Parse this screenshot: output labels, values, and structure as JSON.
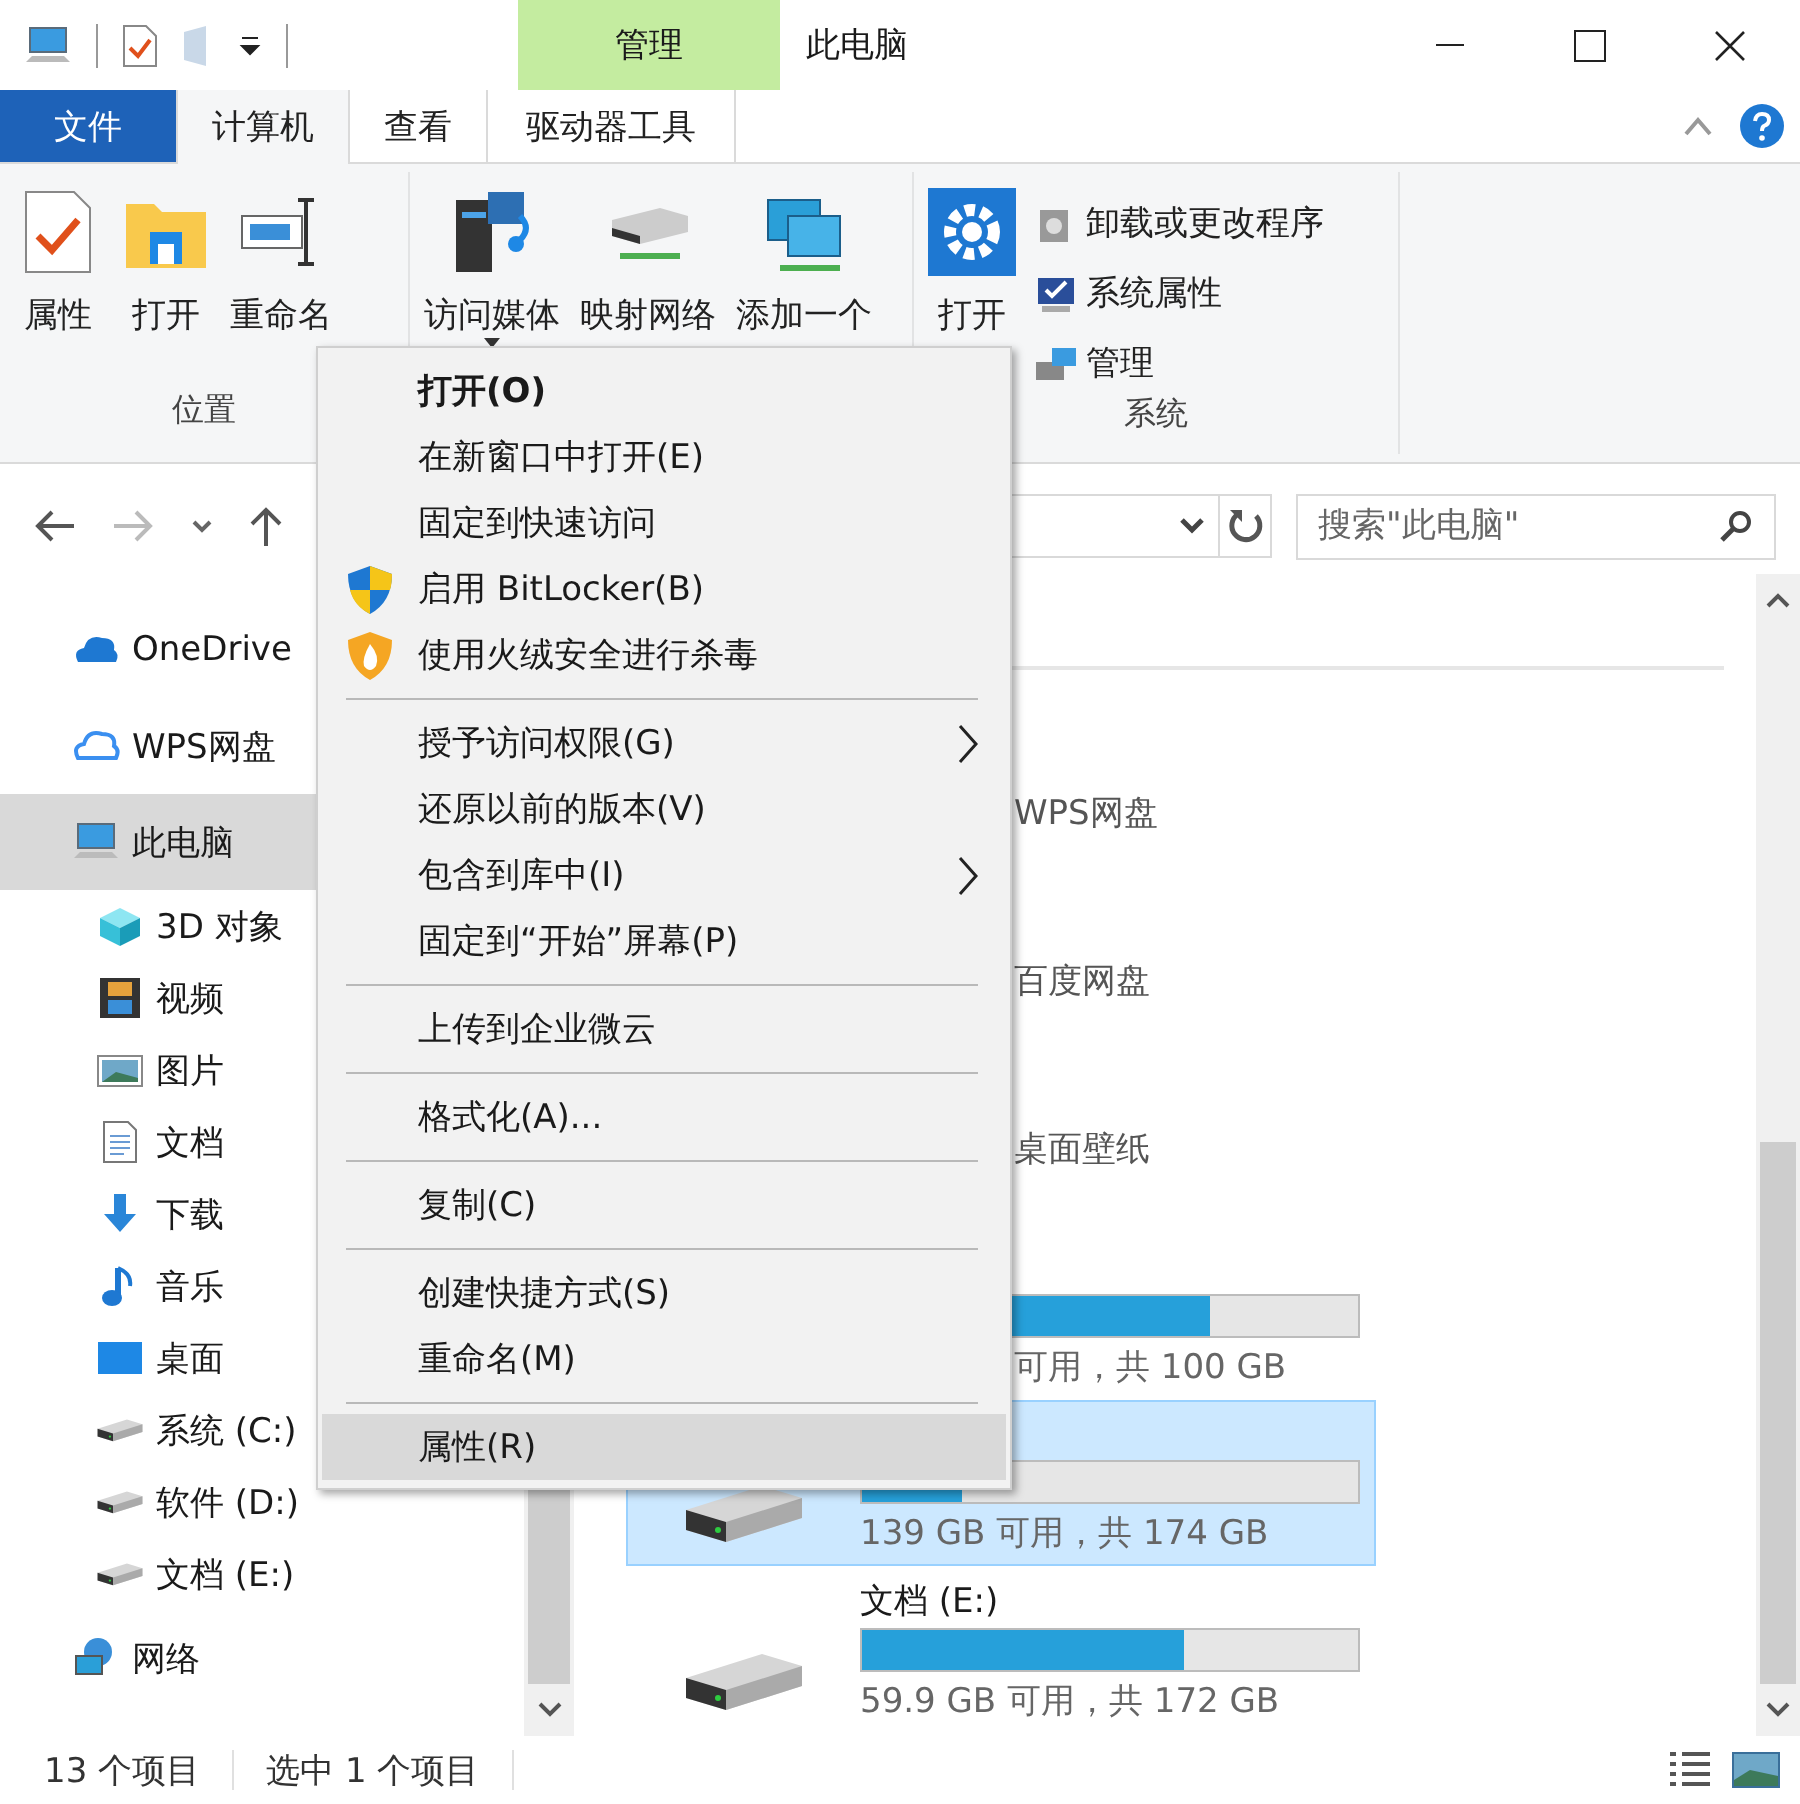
{
  "title_bar": {
    "contextual_tab": "管理",
    "title": "此电脑"
  },
  "ribbon_tabs": [
    {
      "label": "文件",
      "kind": "file",
      "selected": false
    },
    {
      "label": "计算机",
      "kind": "tab",
      "selected": true
    },
    {
      "label": "查看",
      "kind": "tab",
      "selected": false
    },
    {
      "label": "驱动器工具",
      "kind": "contextual",
      "selected": false
    }
  ],
  "ribbon_groups": [
    {
      "label": "位置",
      "buttons": [
        {
          "label": "属性",
          "dropdown": false
        },
        {
          "label": "打开",
          "dropdown": false
        },
        {
          "label": "重命名",
          "dropdown": false
        }
      ]
    },
    {
      "buttons": [
        {
          "label": "访问媒体",
          "dropdown": true
        },
        {
          "label": "映射网络",
          "dropdown": false
        },
        {
          "label": "添加一个",
          "dropdown": false
        }
      ]
    },
    {
      "label": "系统",
      "buttons": [
        {
          "label": "打开",
          "dropdown": false
        }
      ],
      "small_buttons": [
        "卸载或更改程序",
        "系统属性",
        "管理"
      ]
    }
  ],
  "search": {
    "placeholder": "搜索\"此电脑\""
  },
  "sidebar": [
    {
      "label": "OneDrive",
      "selected": false
    },
    {
      "label": "WPS网盘",
      "selected": false
    },
    {
      "label": "此电脑",
      "selected": true,
      "children": [
        {
          "label": "3D 对象",
          "selected": false
        },
        {
          "label": "视频",
          "selected": false
        },
        {
          "label": "图片",
          "selected": false
        },
        {
          "label": "文档",
          "selected": false
        },
        {
          "label": "下载",
          "selected": false
        },
        {
          "label": "音乐",
          "selected": false
        },
        {
          "label": "桌面",
          "selected": false
        },
        {
          "label": "系统 (C:)",
          "selected": false
        },
        {
          "label": "软件 (D:)",
          "selected": false
        },
        {
          "label": "文档 (E:)",
          "selected": false
        }
      ]
    },
    {
      "label": "网络",
      "selected": false
    }
  ],
  "content": {
    "folders": [
      "WPS网盘",
      "百度网盘",
      "桌面壁纸"
    ],
    "drives": [
      {
        "selected": false,
        "level": 0.7,
        "info": "可用，共 100 GB"
      },
      {
        "selected": true,
        "level": 0.2,
        "info": "139 GB 可用，共 174 GB"
      },
      {
        "name": "文档 (E:)",
        "selected": false,
        "level": 0.65,
        "info": "59.9 GB 可用，共 172 GB"
      }
    ]
  },
  "context_menu": {
    "sections": [
      [
        {
          "label": "打开(O)",
          "bold": true,
          "submenu": false,
          "selected": false
        },
        {
          "label": "在新窗口中打开(E)",
          "bold": false,
          "submenu": false,
          "selected": false
        },
        {
          "label": "固定到快速访问",
          "bold": false,
          "submenu": false,
          "selected": false
        },
        {
          "label": "启用 BitLocker(B)",
          "bold": false,
          "submenu": false,
          "selected": false
        },
        {
          "label": "使用火绒安全进行杀毒",
          "bold": false,
          "submenu": false,
          "selected": false
        }
      ],
      [
        {
          "label": "授予访问权限(G)",
          "bold": false,
          "submenu": true,
          "selected": false
        },
        {
          "label": "还原以前的版本(V)",
          "bold": false,
          "submenu": false,
          "selected": false
        },
        {
          "label": "包含到库中(I)",
          "bold": false,
          "submenu": true,
          "selected": false
        },
        {
          "label": "固定到“开始”屏幕(P)",
          "bold": false,
          "submenu": false,
          "selected": false
        }
      ],
      [
        {
          "label": "上传到企业微云",
          "bold": false,
          "submenu": false,
          "selected": false
        }
      ],
      [
        {
          "label": "格式化(A)...",
          "bold": false,
          "submenu": false,
          "selected": false
        }
      ],
      [
        {
          "label": "复制(C)",
          "bold": false,
          "submenu": false,
          "selected": false
        }
      ],
      [
        {
          "label": "创建快捷方式(S)",
          "bold": false,
          "submenu": false,
          "selected": false
        },
        {
          "label": "重命名(M)",
          "bold": false,
          "submenu": false,
          "selected": false
        }
      ],
      [
        {
          "label": "属性(R)",
          "bold": false,
          "submenu": false,
          "selected": true
        }
      ]
    ]
  },
  "status_bar": {
    "item_count": "13 个项目",
    "selection": "选中 1 个项目"
  }
}
